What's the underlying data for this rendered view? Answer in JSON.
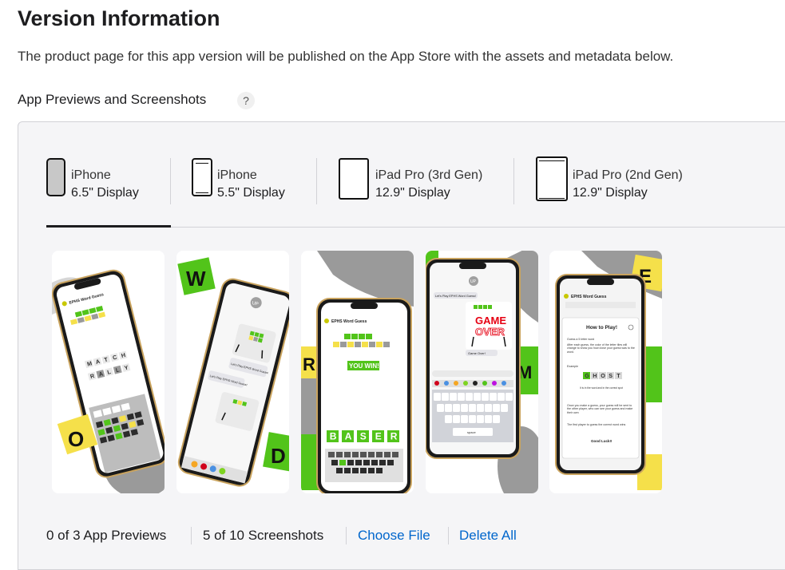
{
  "page": {
    "title": "Version Information",
    "subtitle": "The product page for this app version will be published on the App Store with the assets and metadata below.",
    "section_heading": "App Previews and Screenshots",
    "help_symbol": "?"
  },
  "device_tabs": [
    {
      "line1": "iPhone",
      "line2": "6.5\" Display",
      "icon": "iphone-icon",
      "selected": true
    },
    {
      "line1": "iPhone",
      "line2": "5.5\" Display",
      "icon": "iphone-home-button-icon",
      "selected": false
    },
    {
      "line1": "iPad Pro (3rd Gen)",
      "line2": "12.9\" Display",
      "icon": "ipad-icon",
      "selected": false
    },
    {
      "line1": "iPad Pro (2nd Gen)",
      "line2": "12.9\" Display",
      "icon": "ipad-home-button-icon",
      "selected": false
    }
  ],
  "screenshots": {
    "shot1": {
      "header": "EPHS Word Guess",
      "letters": [
        "M",
        "A",
        "T",
        "C",
        "H",
        "R",
        "A",
        "L",
        "L",
        "Y"
      ]
    },
    "shot2": {
      "messages": [
        "Let's Play EPHS Word Guess!",
        "Let's Play EPHS Word Guess!"
      ],
      "avatar": "UP",
      "big_letters": [
        "W",
        "O",
        "D"
      ]
    },
    "shot3": {
      "header": "EPHS Word Guess",
      "win_text": "YOU WIN!",
      "answer": [
        "B",
        "A",
        "S",
        "E",
        "R"
      ]
    },
    "shot4": {
      "title1": "GAME",
      "title2": "OVER",
      "bubble": "Game Over!",
      "preview": "Let's Play EPHS Word Guess!",
      "avatar": "UP",
      "space": "space"
    },
    "shot5": {
      "header": "EPHS Word Guess",
      "modal_title": "How to Play!",
      "rules": [
        "Guess a 5 letter word",
        "After each guess, the color of the letter tiles will change to show you how close your guess was to the word.",
        "Example",
        "It is in the word and in the correct spot",
        "Once you make a guess, your guess will be sent to the other player, who can see your guess and make their own",
        "The first player to guess the correct word wins"
      ],
      "example_word": [
        "G",
        "H",
        "O",
        "S",
        "T"
      ],
      "good_luck": "Good Luck!!"
    }
  },
  "footer": {
    "previews": "0 of 3 App Previews",
    "screenshots": "5 of 10 Screenshots",
    "choose_file": "Choose File",
    "delete_all": "Delete All"
  },
  "colors": {
    "accent_link": "#0066cc",
    "tile_green": "#52c41a",
    "tile_yellow": "#f5e04a",
    "tile_gray": "#9a9a9a"
  }
}
